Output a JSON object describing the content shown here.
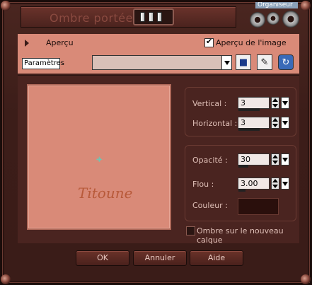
{
  "window": {
    "title": "Ombre portée",
    "organiseur_label": "Organiseur"
  },
  "toolbar": {
    "apercu_label": "Aperçu",
    "apercu_image_label": "Aperçu de l'image",
    "apercu_image_checked": true,
    "parametres_label": "Paramètres",
    "preset_value": "",
    "save_icon": "save-icon",
    "delete_icon": "delete-preset-icon",
    "reset_icon": "reset-icon"
  },
  "preview": {
    "watermark_text": "Titoune",
    "crosshair_icon": "crosshair-icon"
  },
  "offset": {
    "vertical_label": "Vertical :",
    "vertical_value": "3",
    "horizontal_label": "Horizontal :",
    "horizontal_value": "3"
  },
  "shadow": {
    "opacity_label": "Opacité :",
    "opacity_value": "30",
    "blur_label": "Flou :",
    "blur_value": "3.00",
    "color_label": "Couleur :",
    "color_value": "#2a0f0c"
  },
  "new_layer": {
    "label": "Ombre sur le nouveau calque",
    "checked": false
  },
  "buttons": {
    "ok": "OK",
    "cancel": "Annuler",
    "help": "Aide"
  },
  "colors": {
    "panel": "#d98a78",
    "dark": "#4a2420",
    "frame": "#3c1d19"
  }
}
